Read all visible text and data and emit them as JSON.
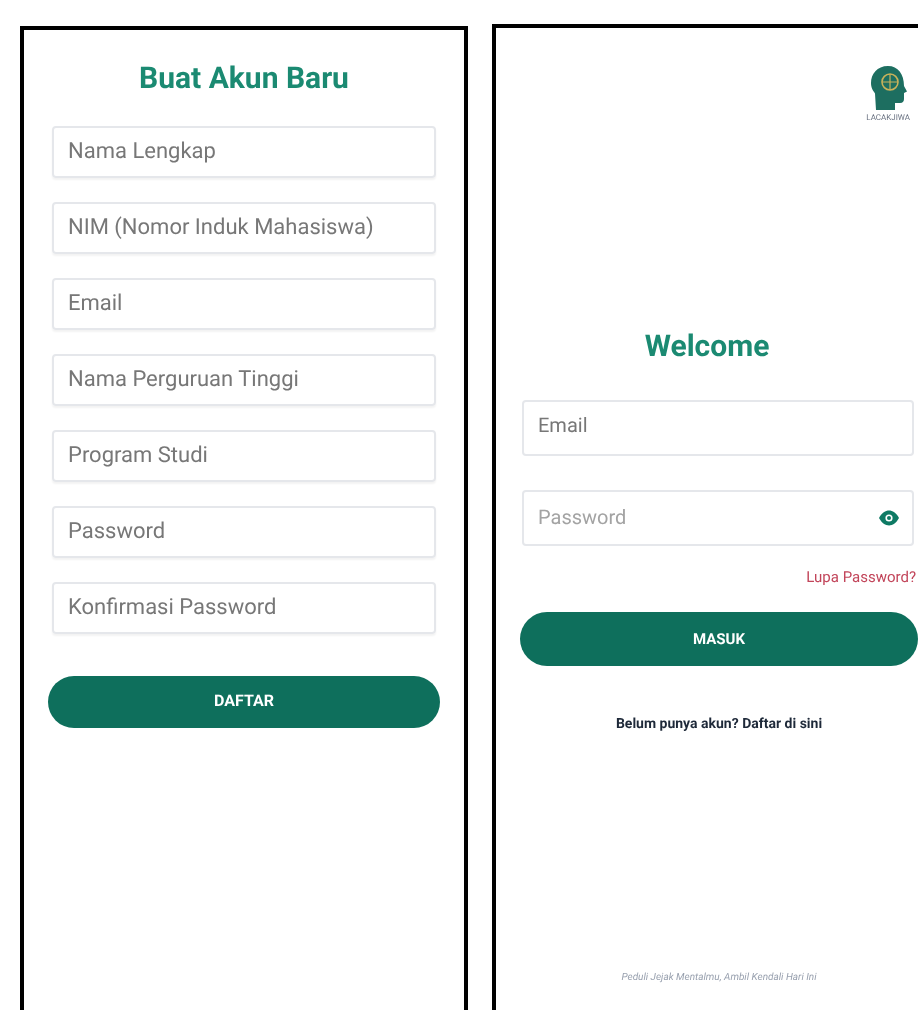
{
  "register": {
    "title": "Buat Akun Baru",
    "fields": [
      {
        "placeholder": "Nama Lengkap"
      },
      {
        "placeholder": "NIM (Nomor Induk Mahasiswa)"
      },
      {
        "placeholder": "Email"
      },
      {
        "placeholder": "Nama Perguruan Tinggi"
      },
      {
        "placeholder": "Program Studi"
      },
      {
        "placeholder": "Password"
      },
      {
        "placeholder": "Konfirmasi Password"
      }
    ],
    "button": "DAFTAR"
  },
  "login": {
    "logo_text": "LACAKJIWA",
    "title": "Welcome",
    "fields": [
      {
        "placeholder": "Email",
        "kind": "text"
      },
      {
        "placeholder": "Password",
        "kind": "password"
      }
    ],
    "forgot_link": "Lupa Password?",
    "button": "MASUK",
    "register_link": "Belum punya akun? Daftar di sini",
    "footer": "Peduli Jejak Mentalmu, Ambil Kendali Hari Ini"
  }
}
